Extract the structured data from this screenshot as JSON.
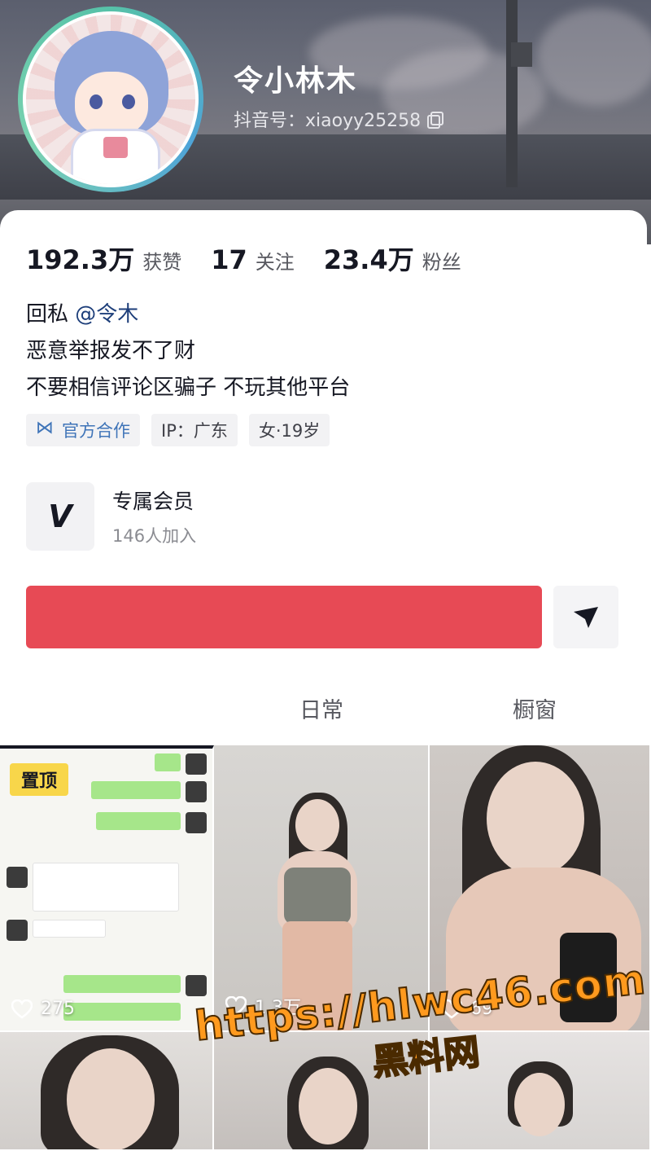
{
  "profile": {
    "nickname": "令小林木",
    "douyin_id": "抖音号：xiaoyy25258",
    "copy_icon": "copy-icon"
  },
  "stats": [
    {
      "value": "192.3万",
      "label": "获赞"
    },
    {
      "value": "17",
      "label": "关注"
    },
    {
      "value": "23.4万",
      "label": "粉丝"
    }
  ],
  "bio": {
    "line1_prefix": "回私 ",
    "line1_mention": "@令木",
    "line2": "恶意举报发不了财",
    "line3": "不要相信评论区骗子  不玩其他平台"
  },
  "tags": {
    "official": "官方合作",
    "ip": "IP：广东",
    "gender_age": "女·19岁"
  },
  "member": {
    "logo": "V",
    "title": "专属会员",
    "subtitle": "146人加入"
  },
  "actions": {
    "follow_color": "#e74a55",
    "share_icon": "share-arrow-icon"
  },
  "tabs": {
    "daily": "日常",
    "window": "橱窗"
  },
  "videos": [
    {
      "pinned": "置顶",
      "likes": "275"
    },
    {
      "likes": "1.3万"
    },
    {
      "likes": "69"
    },
    {
      "likes": ""
    },
    {
      "likes": ""
    },
    {
      "likes": ""
    }
  ],
  "watermark": {
    "url": "https://hlwc46.com",
    "name": "黑料网"
  }
}
